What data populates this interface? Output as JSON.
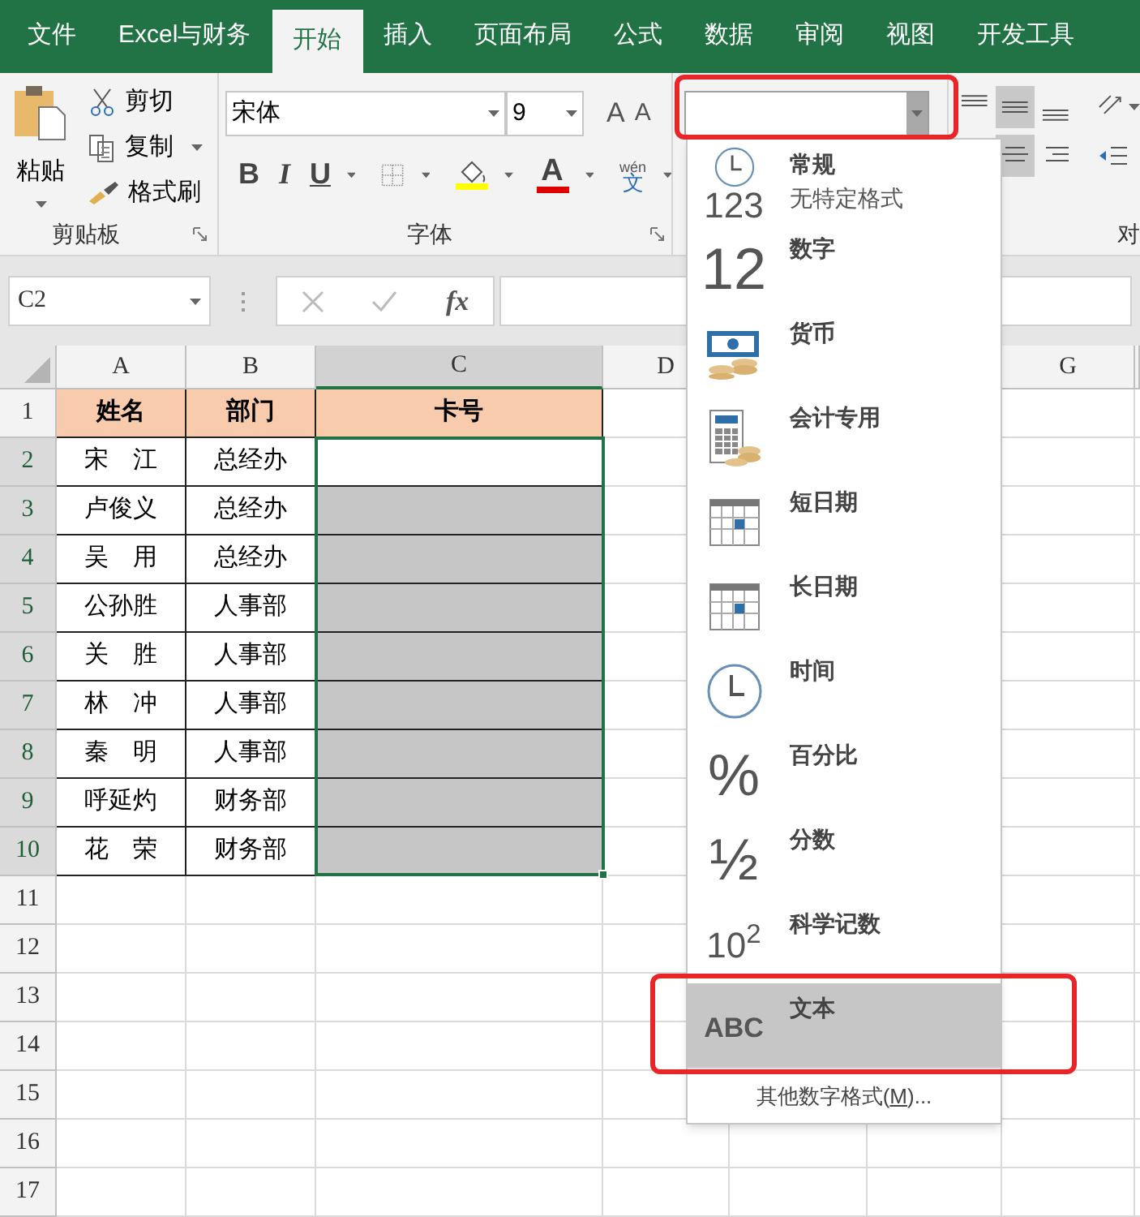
{
  "tabs": [
    {
      "label": "文件",
      "selected": false
    },
    {
      "label": "Excel与财务",
      "selected": false
    },
    {
      "label": "开始",
      "selected": true
    },
    {
      "label": "插入",
      "selected": false
    },
    {
      "label": "页面布局",
      "selected": false
    },
    {
      "label": "公式",
      "selected": false
    },
    {
      "label": "数据",
      "selected": false
    },
    {
      "label": "审阅",
      "selected": false
    },
    {
      "label": "视图",
      "selected": false
    },
    {
      "label": "开发工具",
      "selected": false
    }
  ],
  "ribbon": {
    "clipboard": {
      "paste": "粘贴",
      "cut": "剪切",
      "copy": "复制",
      "format_painter": "格式刷",
      "group_label": "剪贴板"
    },
    "font": {
      "font_name": "宋体",
      "font_size": "9",
      "grow": "A",
      "shrink": "A",
      "bold": "B",
      "italic": "I",
      "underline": "U",
      "font_color": "A",
      "phonetic_pinyin": "wén",
      "phonetic_char": "文",
      "group_label": "字体"
    },
    "alignment": {
      "group_label": "对"
    }
  },
  "formula_bar": {
    "name_box": "C2",
    "fx": "fx"
  },
  "sheet": {
    "columns": [
      {
        "letter": "A",
        "selected": false
      },
      {
        "letter": "B",
        "selected": false
      },
      {
        "letter": "C",
        "selected": true
      },
      {
        "letter": "D",
        "selected": false
      },
      {
        "letter": "G",
        "selected": false
      }
    ],
    "rows": [
      {
        "number": "1",
        "kind": "header",
        "cells": [
          "姓名",
          "部门",
          "卡号"
        ],
        "selected": false
      },
      {
        "number": "2",
        "kind": "record",
        "cells": [
          "宋　江",
          "总经办"
        ],
        "selected": true,
        "active": true
      },
      {
        "number": "3",
        "kind": "record",
        "cells": [
          "卢俊义",
          "总经办"
        ],
        "selected": true,
        "active": false
      },
      {
        "number": "4",
        "kind": "record",
        "cells": [
          "吴　用",
          "总经办"
        ],
        "selected": true,
        "active": false
      },
      {
        "number": "5",
        "kind": "record",
        "cells": [
          "公孙胜",
          "人事部"
        ],
        "selected": true,
        "active": false
      },
      {
        "number": "6",
        "kind": "record",
        "cells": [
          "关　胜",
          "人事部"
        ],
        "selected": true,
        "active": false
      },
      {
        "number": "7",
        "kind": "record",
        "cells": [
          "林　冲",
          "人事部"
        ],
        "selected": true,
        "active": false
      },
      {
        "number": "8",
        "kind": "record",
        "cells": [
          "秦　明",
          "人事部"
        ],
        "selected": true,
        "active": false
      },
      {
        "number": "9",
        "kind": "record",
        "cells": [
          "呼延灼",
          "财务部"
        ],
        "selected": true,
        "active": false
      },
      {
        "number": "10",
        "kind": "record",
        "cells": [
          "花　荣",
          "财务部"
        ],
        "selected": true,
        "active": false
      },
      {
        "number": "11",
        "kind": "empty",
        "selected": false
      },
      {
        "number": "12",
        "kind": "empty",
        "selected": false
      },
      {
        "number": "13",
        "kind": "empty",
        "selected": false
      },
      {
        "number": "14",
        "kind": "empty",
        "selected": false
      },
      {
        "number": "15",
        "kind": "empty",
        "selected": false
      },
      {
        "number": "16",
        "kind": "empty",
        "selected": false
      },
      {
        "number": "17",
        "kind": "empty",
        "selected": false
      }
    ]
  },
  "number_format_field": {
    "highlighted": true
  },
  "number_format_menu": {
    "items": [
      {
        "kind": "general",
        "label": "常规",
        "description": "无特定格式",
        "icon_text": "123",
        "selected": false,
        "highlighted": false
      },
      {
        "kind": "number",
        "label": "数字",
        "icon_text": "12",
        "selected": false,
        "highlighted": false
      },
      {
        "kind": "currency",
        "label": "货币",
        "selected": false,
        "highlighted": false
      },
      {
        "kind": "accounting",
        "label": "会计专用",
        "selected": false,
        "highlighted": false
      },
      {
        "kind": "short_date",
        "label": "短日期",
        "selected": false,
        "highlighted": false
      },
      {
        "kind": "long_date",
        "label": "长日期",
        "selected": false,
        "highlighted": false
      },
      {
        "kind": "time",
        "label": "时间",
        "selected": false,
        "highlighted": false
      },
      {
        "kind": "percent",
        "label": "百分比",
        "icon_text": "%",
        "selected": false,
        "highlighted": false
      },
      {
        "kind": "fraction",
        "label": "分数",
        "icon_text": "½",
        "selected": false,
        "highlighted": false
      },
      {
        "kind": "scientific",
        "label": "科学记数",
        "icon_text": "10$^{2}$",
        "selected": false,
        "highlighted": false
      },
      {
        "kind": "text",
        "label": "文本",
        "icon_text": "ABC",
        "selected": true,
        "highlighted": true
      }
    ],
    "more": {
      "before": "其他数字格式(",
      "access_key": "M",
      "after": ")..."
    }
  }
}
